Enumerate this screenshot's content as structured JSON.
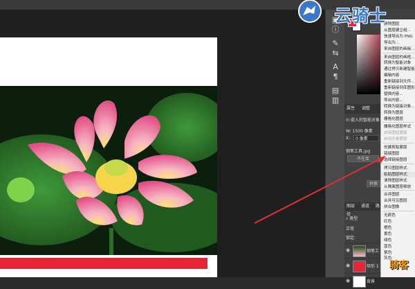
{
  "watermark": {
    "logo_text": "云骑士",
    "corner_text": "骑客"
  },
  "toolbar_icons": [
    "info-icon",
    "brush-icon",
    "adjust-icon",
    "text-icon",
    "paragraph-icon",
    "library-icon",
    "note-icon"
  ],
  "colors": {
    "foreground": "#e82536",
    "background": "#ffffff",
    "red_bar": "#e82536",
    "arrow": "#e03030"
  },
  "properties": {
    "tabs": [
      "属性",
      "调整"
    ],
    "smart_object_label": "嵌入的智能对象",
    "width_label": "W:",
    "width_value": "1500 像素",
    "x_label": "X:",
    "x_value": "0 像素",
    "file_name": "钢笔工具.jpg",
    "placeholder_button": "不在库",
    "convert_button": "转换"
  },
  "layers": {
    "tabs": [
      "图层",
      "通道",
      "路径"
    ],
    "filter_label": "类型",
    "blend_mode": "正常",
    "lock_label": "锁定:",
    "rows": [
      {
        "name": "钢笔工",
        "thumb": "photo"
      },
      {
        "name": "矩形 1",
        "thumb": "red"
      },
      {
        "name": "背景",
        "thumb": "white"
      }
    ]
  },
  "context_menu": {
    "items": [
      {
        "label": "删除图层",
        "disabled": false
      },
      {
        "label": "从图层建立组...",
        "disabled": false
      },
      {
        "label": "快速导出为 PNG",
        "disabled": false
      },
      {
        "label": "导出为...",
        "disabled": false
      },
      {
        "label": "来自图层的画板...",
        "disabled": false
      },
      {
        "label": "来自图层的画框...",
        "disabled": false
      },
      {
        "label": "转换为智能对象",
        "disabled": false
      },
      {
        "label": "通过拷贝新建智能对象",
        "disabled": false
      },
      {
        "label": "编辑内容",
        "disabled": false
      },
      {
        "label": "重新链接到文件...",
        "disabled": false
      },
      {
        "label": "重新链接到库图形...",
        "disabled": false
      },
      {
        "label": "替换内容...",
        "disabled": false
      },
      {
        "label": "导出内容...",
        "disabled": false
      },
      {
        "label": "转换为链接对象...",
        "disabled": false
      },
      {
        "label": "转换为图层",
        "disabled": false
      },
      {
        "label": "栅格化图层",
        "disabled": false
      },
      {
        "label": "栅格化图层样式",
        "disabled": false
      },
      {
        "label": "启用图层蒙版",
        "disabled": true
      },
      {
        "label": "启用矢量蒙版",
        "disabled": true
      },
      {
        "label": "创建剪贴蒙版",
        "disabled": false
      },
      {
        "label": "链接图层",
        "disabled": false
      },
      {
        "label": "选择链接图层",
        "disabled": false
      },
      {
        "label": "拷贝图层样式",
        "disabled": false
      },
      {
        "label": "粘贴图层样式",
        "disabled": false
      },
      {
        "label": "清除图层样式",
        "disabled": false
      },
      {
        "label": "从隔离图层释放",
        "disabled": false
      },
      {
        "label": "合并图层",
        "disabled": false
      },
      {
        "label": "合并可见图层",
        "disabled": false
      },
      {
        "label": "拼合图像",
        "disabled": false
      },
      {
        "label": "无颜色",
        "disabled": false
      },
      {
        "label": "红色",
        "disabled": false
      },
      {
        "label": "橙色",
        "disabled": false
      },
      {
        "label": "黄色",
        "disabled": false
      },
      {
        "label": "绿色",
        "disabled": false
      },
      {
        "label": "蓝色",
        "disabled": false
      },
      {
        "label": "紫色",
        "disabled": false
      },
      {
        "label": "灰色",
        "disabled": false
      }
    ]
  }
}
